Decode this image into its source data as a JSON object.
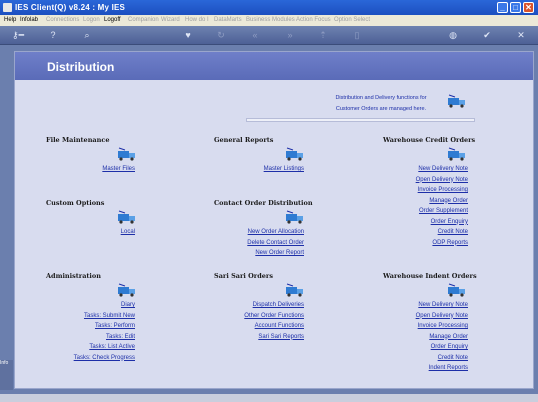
{
  "window": {
    "title": "IES Client(Q) v8.24 : My IES",
    "controls": {
      "minimize": "_",
      "maximize": "□",
      "close": "✕"
    }
  },
  "menubar": {
    "items": [
      {
        "label": "Help",
        "enabled": true
      },
      {
        "label": "Infolab",
        "enabled": true
      },
      {
        "label": "Connections",
        "enabled": false
      },
      {
        "label": "Logon",
        "enabled": false
      },
      {
        "label": "Logoff",
        "enabled": true
      },
      {
        "label": "Companion",
        "enabled": false
      },
      {
        "label": "Wizard",
        "enabled": false
      },
      {
        "label": "How do I",
        "enabled": false
      },
      {
        "label": "DataMarts",
        "enabled": false
      },
      {
        "label": "Business Modules",
        "enabled": false
      },
      {
        "label": "Action Focus",
        "enabled": false
      },
      {
        "label": "Option Select",
        "enabled": false
      }
    ]
  },
  "toolbar": {
    "icons": [
      "key-icon",
      "help-icon",
      "search-icon",
      "heart-icon",
      "refresh-icon",
      "rewind-icon",
      "forward-icon",
      "cursor-icon",
      "page-icon",
      "globe-icon",
      "check-icon",
      "close-icon"
    ]
  },
  "page": {
    "title": "Distribution",
    "intro_line1": "Distribution and Delivery functions for",
    "intro_line2": "Customer Orders are managed here."
  },
  "sections": {
    "file_maintenance": {
      "title": "File Maintenance",
      "links": [
        "Master Files"
      ]
    },
    "general_reports": {
      "title": "General Reports",
      "links": [
        "Master Listings"
      ]
    },
    "warehouse_credit_orders": {
      "title": "Warehouse Credit Orders",
      "links": [
        "New Delivery Note",
        "Open Delivery Note",
        "Invoice Processing",
        "Manage Order",
        "Order Supplement",
        "Order Enquiry",
        "Credit Note",
        "ODP Reports"
      ]
    },
    "custom_options": {
      "title": "Custom Options",
      "links": [
        "Local"
      ]
    },
    "contact_order_distribution": {
      "title": "Contact Order Distribution",
      "links": [
        "New Order Allocation",
        "Delete Contact Order",
        "New Order Report"
      ]
    },
    "administration": {
      "title": "Administration",
      "links": [
        "Diary",
        "Tasks: Submit New",
        "Tasks: Perform",
        "Tasks: Edit",
        "Tasks: List Active",
        "Tasks: Check Progress"
      ]
    },
    "sari_sari_orders": {
      "title": "Sari Sari Orders",
      "links": [
        "Dispatch Deliveries",
        "Other Order Functions",
        "Account Functions",
        "Sari Sari Reports"
      ]
    },
    "warehouse_indent_orders": {
      "title": "Warehouse Indent Orders",
      "links": [
        "New Delivery Note",
        "Open Delivery Note",
        "Invoice Processing",
        "Manage Order",
        "Order Enquiry",
        "Credit Note",
        "Indent Reports"
      ]
    }
  },
  "side_fragment": {
    "text": "Info"
  },
  "colors": {
    "link": "#1d2fa8",
    "header": "#5a6bb8",
    "panel": "#d8dcef",
    "titlebar": "#2a67d8"
  }
}
